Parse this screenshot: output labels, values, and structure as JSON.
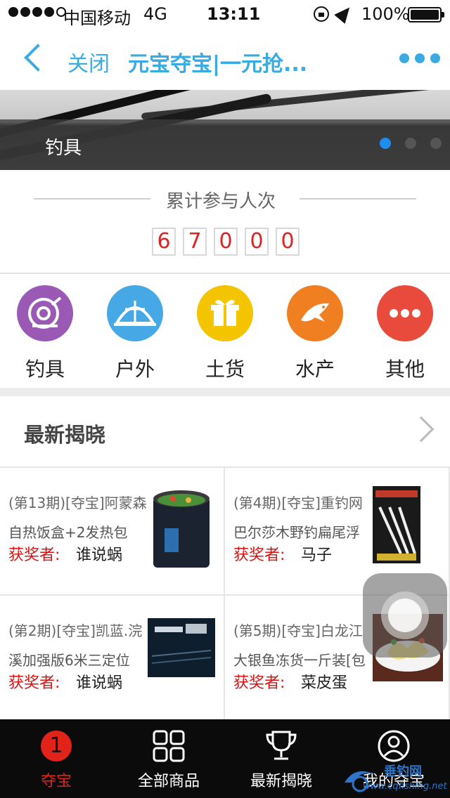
{
  "status_bar": {
    "carrier": "中国移动",
    "network": "4G",
    "time": "13:11",
    "battery": "100%"
  },
  "nav": {
    "close_label": "关闭",
    "title": "元宝夺宝|一元抢..."
  },
  "banner": {
    "caption": "钓具",
    "slide_count": 3,
    "active_slide": 0
  },
  "counter": {
    "title": "累计参与人次",
    "digits": [
      "6",
      "7",
      "0",
      "0",
      "0"
    ]
  },
  "categories": [
    {
      "label": "钓具",
      "icon": "fishing-reel-icon",
      "color": "#9b59b6"
    },
    {
      "label": "户外",
      "icon": "tent-icon",
      "color": "#46a9e6"
    },
    {
      "label": "土货",
      "icon": "gift-icon",
      "color": "#f5c400"
    },
    {
      "label": "水产",
      "icon": "fish-icon",
      "color": "#f07f22"
    },
    {
      "label": "其他",
      "icon": "more-dots-icon",
      "color": "#e84a3c"
    }
  ],
  "latest": {
    "title": "最新揭晓"
  },
  "products": [
    {
      "period": "(第13期)[夺宝]阿蒙森",
      "name": "自热饭盒+2发热包",
      "winner_label": "获奖者:",
      "winner": "谁说蜗"
    },
    {
      "period": "(第4期)[夺宝]重钓网",
      "name": "巴尔莎木野钓扁尾浮",
      "winner_label": "获奖者:",
      "winner": "马子"
    },
    {
      "period": "(第2期)[夺宝]凯蓝.浣",
      "name": "溪加强版6米三定位",
      "winner_label": "获奖者:",
      "winner": "谁说蜗"
    },
    {
      "period": "(第5期)[夺宝]白龙江",
      "name": "大银鱼冻货一斤装[包",
      "winner_label": "获奖者:",
      "winner": "菜皮蛋"
    }
  ],
  "tabs": [
    {
      "label": "夺宝",
      "icon": "badge-one-icon",
      "badge": "1",
      "active": true
    },
    {
      "label": "全部商品",
      "icon": "grid-icon",
      "active": false
    },
    {
      "label": "最新揭晓",
      "icon": "trophy-icon",
      "active": false
    },
    {
      "label": "我的夺宝",
      "icon": "user-icon",
      "active": false
    }
  ],
  "watermark": {
    "text": "垂钓网",
    "url": "www.cqfishing.net"
  },
  "colors": {
    "accent": "#3aabe2",
    "red": "#e2231a",
    "tab_bar": "#0b0b0b"
  }
}
